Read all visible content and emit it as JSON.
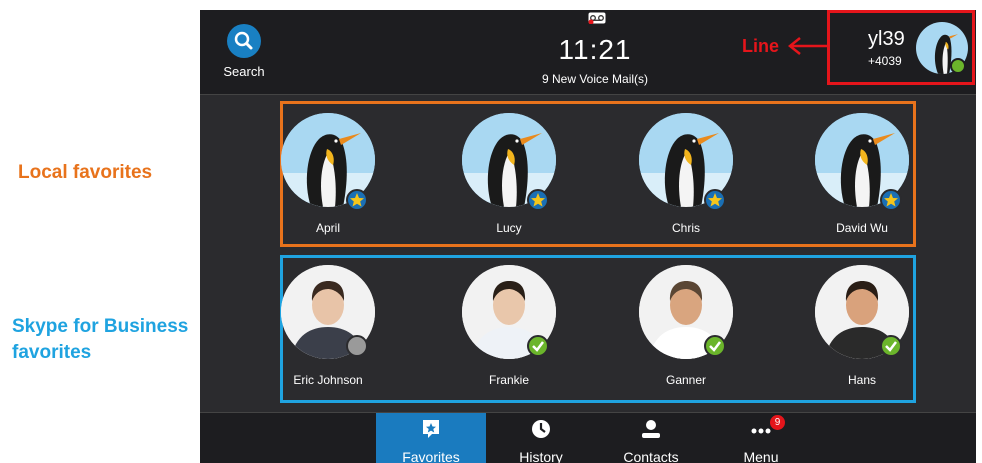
{
  "annotations": {
    "local": "Local favorites",
    "skype_line1": "Skype for Business",
    "skype_line2": "favorites",
    "line": "Line"
  },
  "topbar": {
    "search_label": "Search",
    "time": "11:21",
    "voicemail": "9 New Voice Mail(s)"
  },
  "line": {
    "name": "yl39",
    "number": "+4039",
    "status": "available"
  },
  "local_favorites": [
    {
      "name": "April"
    },
    {
      "name": "Lucy"
    },
    {
      "name": "Chris"
    },
    {
      "name": "David Wu"
    }
  ],
  "skype_favorites": [
    {
      "name": "Eric Johnson",
      "status": "offline"
    },
    {
      "name": "Frankie",
      "status": "available"
    },
    {
      "name": "Ganner",
      "status": "available"
    },
    {
      "name": "Hans",
      "status": "available"
    }
  ],
  "nav": {
    "favorites": "Favorites",
    "history": "History",
    "contacts": "Contacts",
    "menu": "Menu",
    "menu_badge": "9"
  },
  "colors": {
    "local_border": "#e8731c",
    "skype_border": "#1fa3e0",
    "line_border": "#e5151b",
    "active_tab": "#1a7bbf",
    "available": "#6bb52b"
  }
}
